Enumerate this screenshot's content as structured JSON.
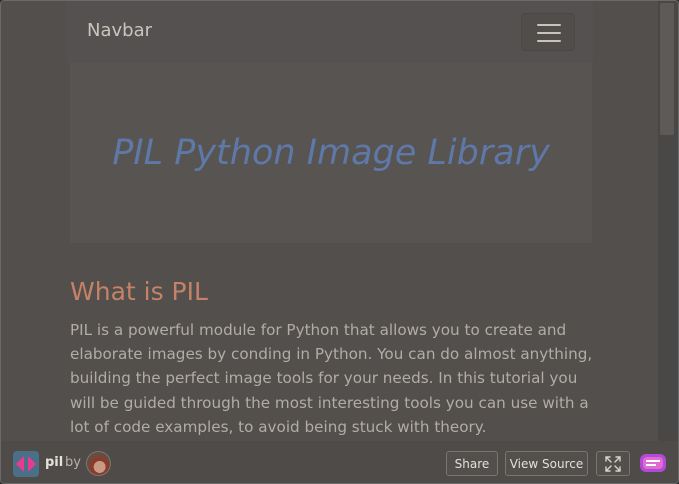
{
  "navbar": {
    "brand": "Navbar",
    "toggler_icon": "hamburger-menu-icon"
  },
  "hero": {
    "title": "PIL Python Image Library"
  },
  "section": {
    "title": "What is PIL",
    "body": "PIL is a powerful module for Python that allows you to create and elaborate images by conding in Python. You can do almost anything, building the perfect image tools for your needs. In this tutorial you will be guided through the most interesting tools you can use with a lot of code examples, to avoid being stuck with theory."
  },
  "footer": {
    "repl_name": "pil",
    "by_label": "by",
    "share_label": "Share",
    "view_source_label": "View Source",
    "icons": {
      "logo": "repl-logo-icon",
      "avatar": "user-avatar",
      "fullscreen": "expand-icon",
      "badge": "replit-badge-icon"
    }
  },
  "colors": {
    "page_background": "#524f4c",
    "hero_title": "#5e78a8",
    "section_title": "#c58266",
    "body_text": "#b2aca6",
    "brand_text": "#c9c4be"
  }
}
